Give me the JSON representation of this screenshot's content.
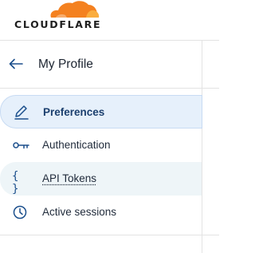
{
  "brand": {
    "name": "CLOUDFLARE",
    "cloud_color": "#f48120",
    "cloud_color_light": "#faad3f"
  },
  "header": {
    "title": "My Profile",
    "back_icon": "arrow-left-icon"
  },
  "nav": {
    "items": [
      {
        "label": "Preferences",
        "icon": "pencil-icon",
        "state": "active"
      },
      {
        "label": "Authentication",
        "icon": "key-icon",
        "state": "default"
      },
      {
        "label": "API Tokens",
        "icon": "braces-icon",
        "state": "hover"
      },
      {
        "label": "Active sessions",
        "icon": "clock-icon",
        "state": "default"
      }
    ]
  },
  "colors": {
    "accent": "#1b4f8c",
    "active_bg": "#e6f0fb",
    "border": "#e3e3e3"
  }
}
